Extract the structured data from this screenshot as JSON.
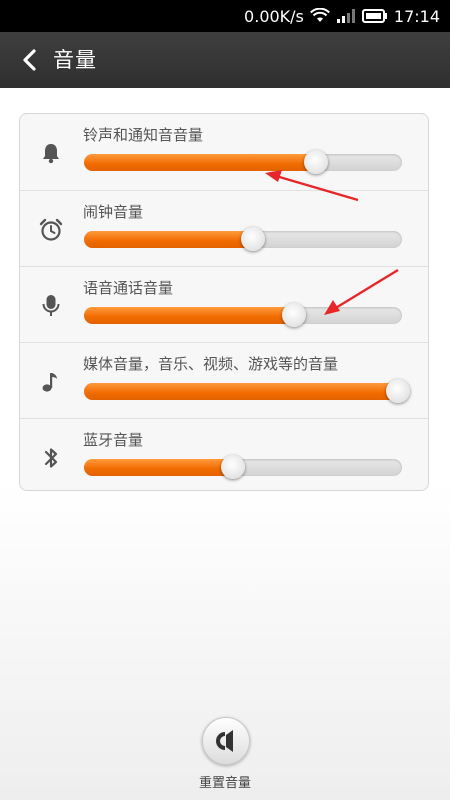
{
  "status_bar": {
    "net_speed": "0.00K/s",
    "time": "17:14",
    "icons": [
      "wifi-icon",
      "signal-icon",
      "battery-icon"
    ]
  },
  "header": {
    "back_icon": "chevron-left-icon",
    "title": "音量"
  },
  "volume_rows": [
    {
      "icon": "bell-icon",
      "label": "铃声和通知音音量",
      "level": 0.73
    },
    {
      "icon": "alarm-clock-icon",
      "label": "闹钟音量",
      "level": 0.53
    },
    {
      "icon": "microphone-icon",
      "label": "语音通话音量",
      "level": 0.66
    },
    {
      "icon": "music-note-icon",
      "label": "媒体音量，音乐、视频、游戏等的音量",
      "level": 1.0
    },
    {
      "icon": "bluetooth-icon",
      "label": "蓝牙音量",
      "level": 0.47
    }
  ],
  "reset": {
    "icon": "speaker-reset-icon",
    "label": "重置音量"
  },
  "colors": {
    "accent": "#f07000",
    "annotation_arrow": "#e8262a"
  }
}
